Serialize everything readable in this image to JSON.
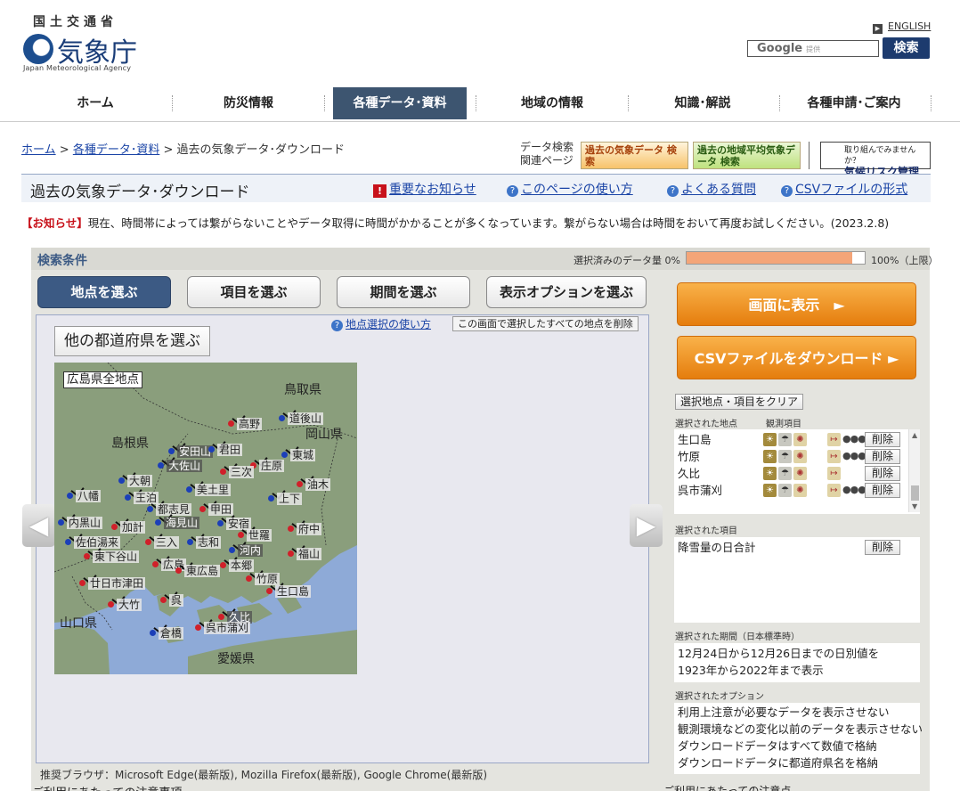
{
  "header": {
    "org_top": "国土交通省",
    "org_main": "気象庁",
    "org_en": "Japan Meteorological Agency",
    "english_link": "ENGLISH",
    "search_google": "Google",
    "search_provided": "提供",
    "search_button": "検索"
  },
  "nav": [
    {
      "label": "ホーム"
    },
    {
      "label": "防災情報"
    },
    {
      "label": "各種データ･資料"
    },
    {
      "label": "地域の情報"
    },
    {
      "label": "知識･解説"
    },
    {
      "label": "各種申請･ご案内"
    }
  ],
  "breadcrumb": {
    "items": [
      "ホーム",
      "各種データ･資料"
    ],
    "current": "過去の気象データ･ダウンロード",
    "sep": ">"
  },
  "related": {
    "label_line1": "データ検索",
    "label_line2": "関連ページ",
    "banner1": "過去の気象データ 検索",
    "banner2": "過去の地域平均気象データ 検索",
    "banner3_small": "取り組んでみませんか？",
    "banner3_main": "気候リスク管理"
  },
  "title_bar": {
    "title": "過去の気象データ･ダウンロード",
    "links": [
      "重要なお知らせ",
      "このページの使い方",
      "よくある質問",
      "CSVファイルの形式"
    ]
  },
  "notice": {
    "label": "【お知らせ】",
    "text": "現在、時間帯によっては繋がらないことやデータ取得に時間がかかることが多くなっています。繋がらない場合は時間をおいて再度お試しください。(2023.2.8)"
  },
  "search_panel": {
    "title": "検索条件",
    "selected_label": "選択済みのデータ量 0%",
    "progress_percent": 0.93,
    "progress_max": "100%（上限）",
    "tabs": [
      {
        "label": "地点を選ぶ",
        "active": true
      },
      {
        "label": "項目を選ぶ",
        "active": false
      },
      {
        "label": "期間を選ぶ",
        "active": false
      },
      {
        "label": "表示オプションを選ぶ",
        "active": false
      }
    ],
    "map_help": "地点選択の使い方",
    "clear_all_button": "この画面で選択したすべての地点を削除",
    "pref_button": "他の都道府県を選ぶ",
    "map_title": "広島県全地点",
    "prefectures": [
      "鳥取県",
      "島根県",
      "岡山県",
      "山口県",
      "愛媛県"
    ],
    "stations": [
      "高野",
      "道後山",
      "安田山",
      "君田",
      "庄原",
      "東城",
      "大朝",
      "大佐山",
      "三次",
      "油木",
      "美土里",
      "八幡",
      "王泊",
      "都志見",
      "上下",
      "甲田",
      "内黒山",
      "加計",
      "海見山",
      "安宿",
      "世羅",
      "府中",
      "佐伯湯来",
      "三入",
      "志和",
      "河内",
      "東下谷山",
      "広島",
      "東広島",
      "本郷",
      "福山",
      "廿日市津田",
      "竹原",
      "生口島",
      "大竹",
      "呉",
      "久比",
      "呉市蒲刈",
      "倉橋"
    ],
    "browser_note": "推奨ブラウザ：Microsoft Edge(最新版), Mozilla Firefox(最新版), Google Chrome(最新版)",
    "cutoff_left": "ご利用にあたっての注意事項",
    "cutoff_right": "ご利用にあたっての注意点"
  },
  "right_panel": {
    "show_button": "画面に表示　►",
    "csv_button": "CSVファイルをダウンロード ►",
    "clear_button": "選択地点・項目をクリア",
    "stations_label": "選択された地点",
    "elements_label": "観測項目",
    "selected_stations": [
      {
        "name": "生口島",
        "delete": "削除"
      },
      {
        "name": "竹原",
        "delete": "削除"
      },
      {
        "name": "久比",
        "delete": "削除"
      },
      {
        "name": "呉市蒲刈",
        "delete": "削除"
      }
    ],
    "items_label": "選択された項目",
    "selected_items": [
      {
        "name": "降雪量の日合計",
        "delete": "削除"
      }
    ],
    "period_label": "選択された期間（日本標準時）",
    "period_lines": [
      "12月24日から12月26日までの日別値を",
      "1923年から2022年まで表示"
    ],
    "options_label": "選択されたオプション",
    "options": [
      "利用上注意が必要なデータを表示させない",
      "観測環境などの変化以前のデータを表示させない",
      "ダウンロードデータはすべて数値で格納",
      "ダウンロードデータに都道府県名を格納"
    ]
  }
}
